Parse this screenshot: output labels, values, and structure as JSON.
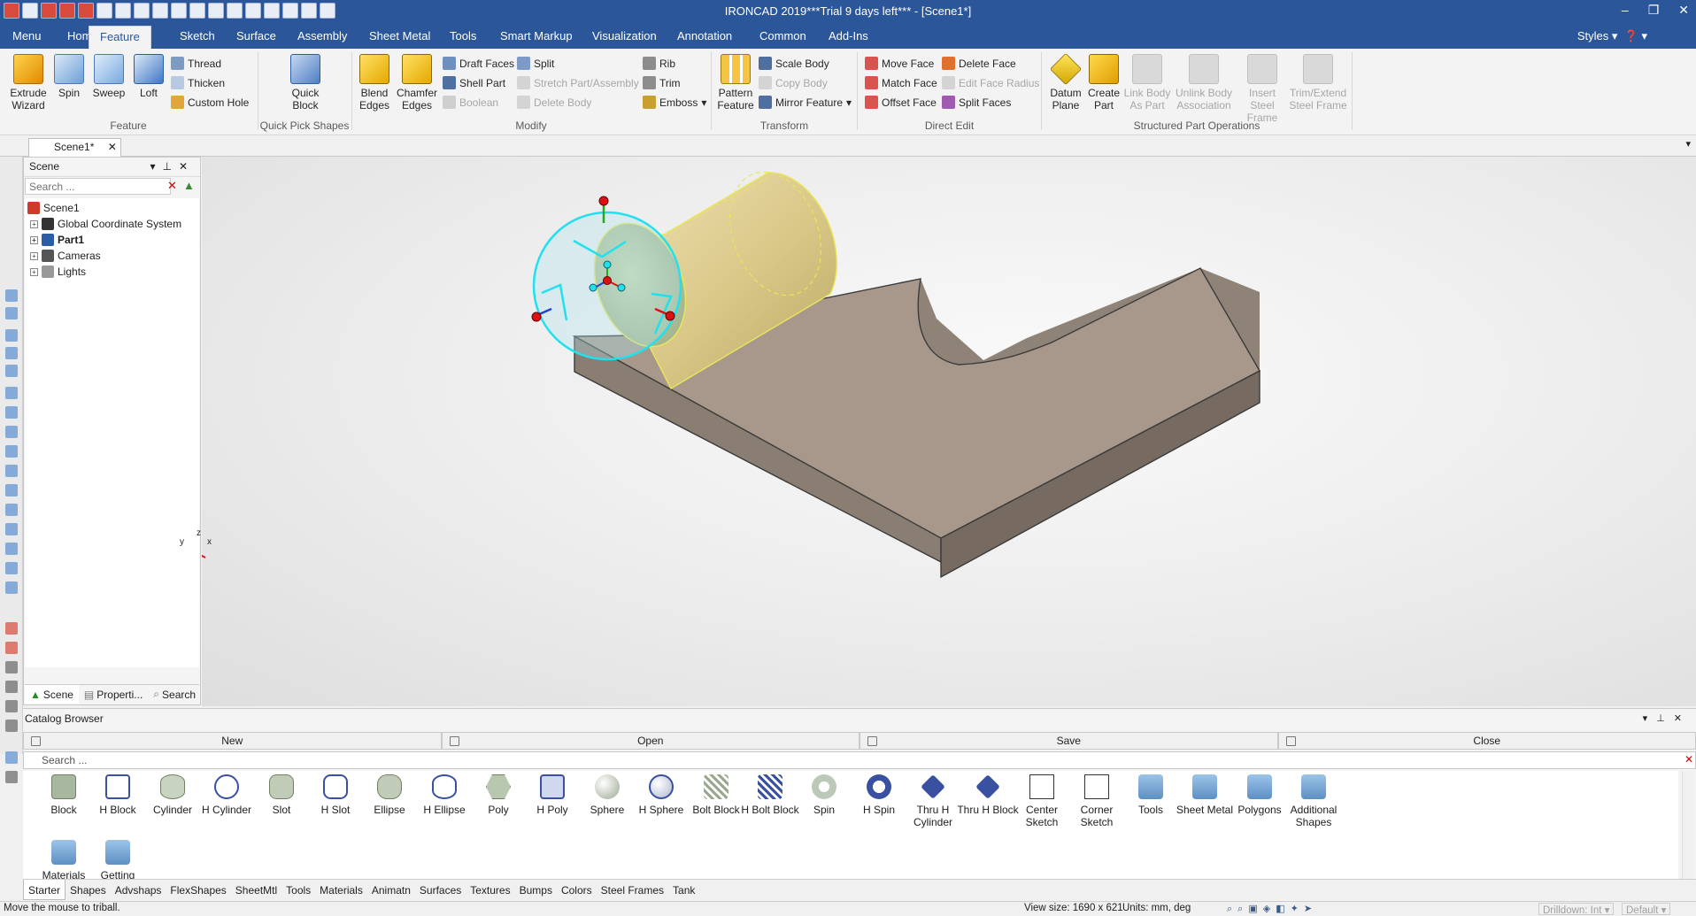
{
  "app": {
    "title": "IRONCAD 2019***Trial 9 days left*** - [Scene1*]"
  },
  "menu": {
    "items": [
      "Menu",
      "Home",
      "Feature",
      "Sketch",
      "Surface",
      "Assembly",
      "Sheet Metal",
      "Tools",
      "Smart Markup",
      "Visualization",
      "Annotation",
      "Common",
      "Add-Ins"
    ],
    "active": "Feature",
    "styles": "Styles"
  },
  "ribbon": {
    "feature": {
      "extrude": "Extrude Wizard",
      "spin": "Spin",
      "sweep": "Sweep",
      "loft": "Loft",
      "thread": "Thread",
      "thicken": "Thicken",
      "custom_hole": "Custom Hole",
      "group": "Feature"
    },
    "quick": {
      "quick_block": "Quick Block",
      "group": "Quick Pick Shapes"
    },
    "modify": {
      "blend": "Blend Edges",
      "chamfer": "Chamfer Edges",
      "draft": "Draft Faces",
      "shell": "Shell Part",
      "boolean": "Boolean",
      "split": "Split",
      "stretch": "Stretch Part/Assembly",
      "delete_body": "Delete Body",
      "rib": "Rib",
      "trim": "Trim",
      "emboss": "Emboss",
      "group": "Modify"
    },
    "transform": {
      "pattern": "Pattern Feature",
      "scale": "Scale Body",
      "copy": "Copy Body",
      "mirror": "Mirror Feature",
      "group": "Transform"
    },
    "direct": {
      "move_face": "Move Face",
      "match_face": "Match Face",
      "offset_face": "Offset Face",
      "delete_face": "Delete Face",
      "edit_radius": "Edit Face Radius",
      "split_faces": "Split Faces",
      "group": "Direct Edit"
    },
    "structured": {
      "datum": "Datum Plane",
      "create_part": "Create Part",
      "link_body": "Link Body As Part",
      "unlink": "Unlink Body Association",
      "insert_steel": "Insert Steel Frame",
      "trim_steel": "Trim/Extend Steel Frame",
      "group": "Structured Part Operations"
    }
  },
  "doc_tab": "Scene1*",
  "scene_panel": {
    "title": "Scene",
    "search_placeholder": "Search ...",
    "tree": [
      "Scene1",
      "Global Coordinate System",
      "Part1",
      "Cameras",
      "Lights"
    ],
    "tabs": [
      "Scene",
      "Properti...",
      "Search"
    ]
  },
  "triball_axes": {
    "x": "x",
    "y": "y",
    "z": "z"
  },
  "catalog": {
    "title": "Catalog Browser",
    "actions": [
      "New",
      "Open",
      "Save",
      "Close"
    ],
    "search_placeholder": "Search ...",
    "items": [
      "Block",
      "H Block",
      "Cylinder",
      "H Cylinder",
      "Slot",
      "H Slot",
      "Ellipse",
      "H Ellipse",
      "Poly",
      "H Poly",
      "Sphere",
      "H Sphere",
      "Bolt Block",
      "H Bolt Block",
      "Spin",
      "H Spin",
      "Thru H Cylinder",
      "Thru H Block",
      "Center Sketch",
      "Corner Sketch",
      "Tools",
      "Sheet Metal",
      "Polygons",
      "Additional Shapes",
      "Materials",
      "Getting"
    ],
    "tabs": [
      "Starter",
      "Shapes",
      "Advshaps",
      "FlexShapes",
      "SheetMtl",
      "Tools",
      "Materials",
      "Animatn",
      "Surfaces",
      "Textures",
      "Bumps",
      "Colors",
      "Steel Frames",
      "Tank"
    ],
    "active_tab": "Starter"
  },
  "status": {
    "message": "Move the mouse to triball.",
    "view_size": "View size: 1690 x 621",
    "units": "Units: mm, deg",
    "drilldown": "Drilldown: Int",
    "default": "Default"
  }
}
